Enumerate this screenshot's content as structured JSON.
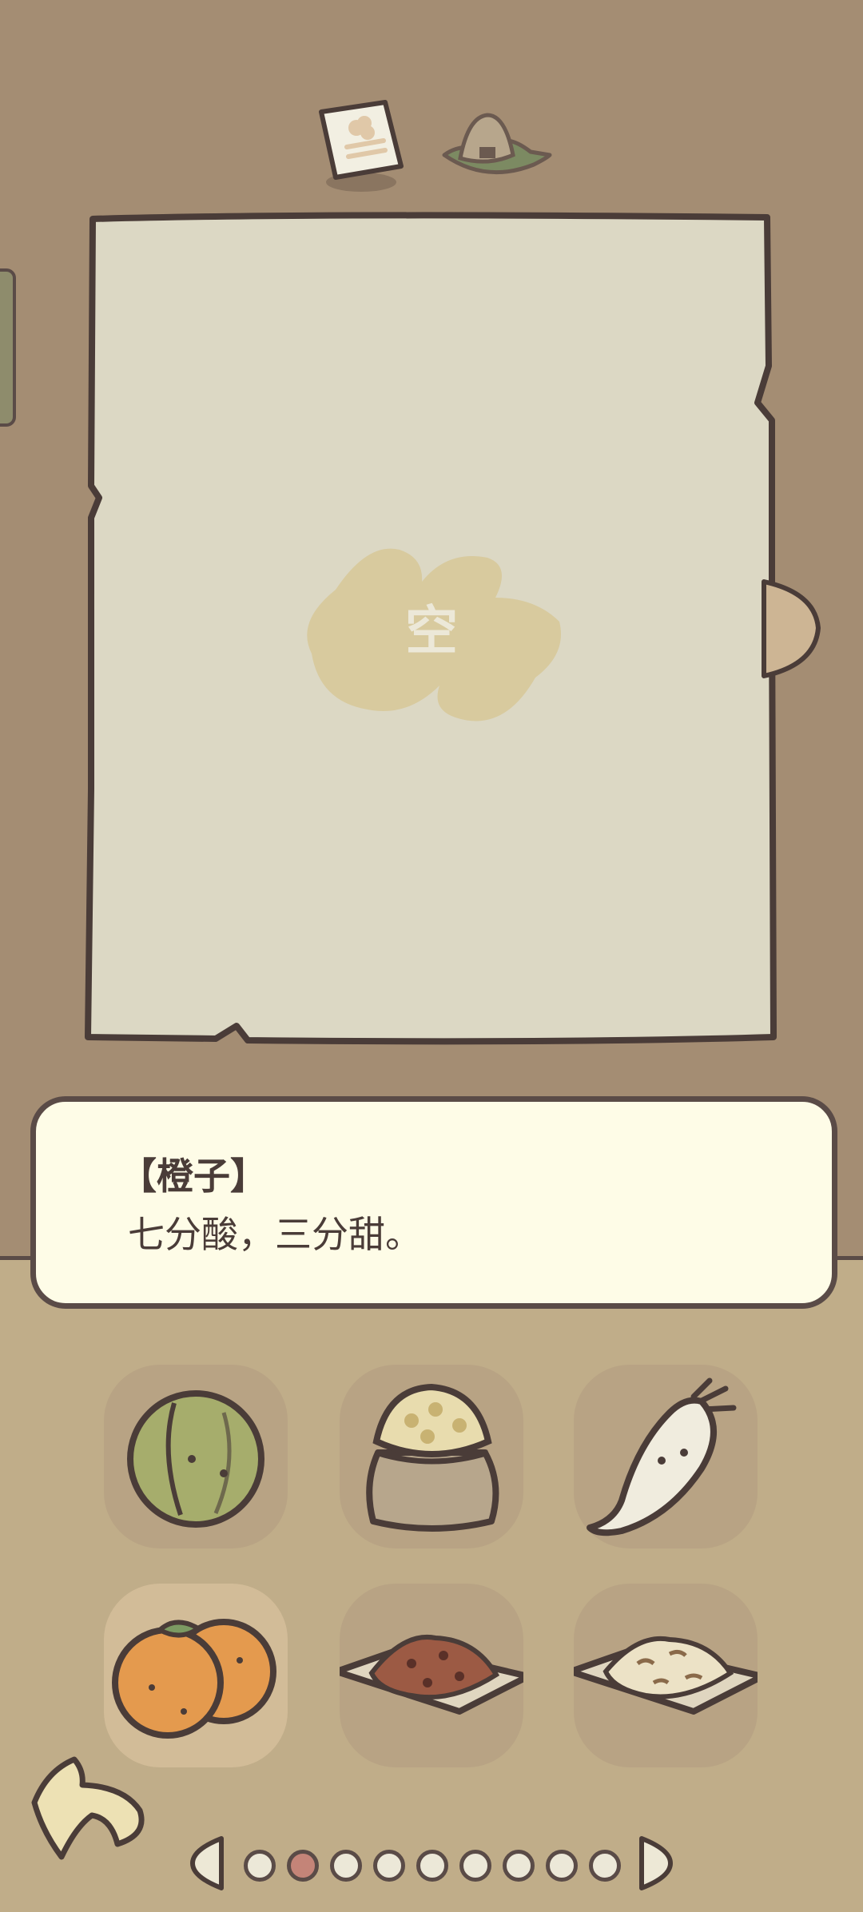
{
  "top_icons": [
    {
      "icon": "recipe-card-icon"
    },
    {
      "icon": "rice-ball-plate-icon"
    }
  ],
  "paper": {
    "empty_label": "空",
    "partial_text": "",
    "color": "#dcd8c4"
  },
  "description": {
    "title": "【橙子】",
    "text": "七分酸，三分甜。"
  },
  "ingredients": [
    {
      "icon": "plum-icon",
      "selected": false
    },
    {
      "icon": "grain-sack-icon",
      "selected": false
    },
    {
      "icon": "radish-icon",
      "selected": false
    },
    {
      "icon": "orange-icon",
      "selected": true
    },
    {
      "icon": "meat-sauce-plate-icon",
      "selected": false
    },
    {
      "icon": "fried-rice-plate-icon",
      "selected": false
    }
  ],
  "pager": {
    "page_count": 9,
    "current_page": 2
  },
  "colors": {
    "background": "#a48d73",
    "bottom_panel": "#c0ad89",
    "outline": "#5a4b47",
    "description_bg": "#fefce7",
    "active_dot": "#c48478"
  }
}
